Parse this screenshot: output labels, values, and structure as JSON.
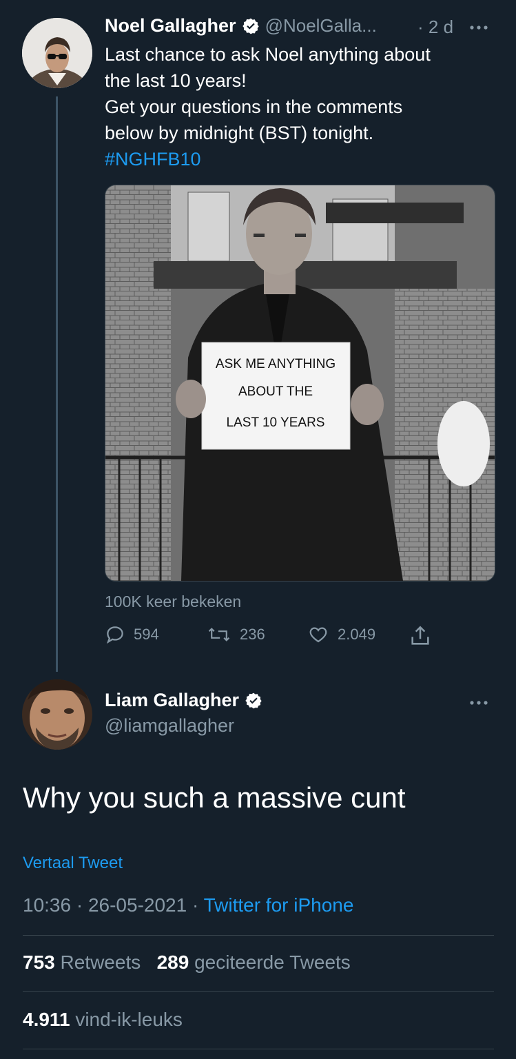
{
  "colors": {
    "background": "#15202b",
    "accent": "#1d9bf0",
    "muted": "#8899a6",
    "divider": "#38444d"
  },
  "parent_tweet": {
    "author_name": "Noel Gallagher",
    "handle": "@NoelGalla...",
    "time": "· 2 d",
    "more_icon": "more-dots-icon",
    "text_line1": "Last chance to ask Noel anything about",
    "text_line2": "the last 10 years!",
    "text_line3": "Get your questions in the comments",
    "text_line4": "below by midnight (BST) tonight.",
    "hashtag": "#NGHFB10",
    "media": {
      "sign_line1": "ASK ME ANYTHING",
      "sign_line2": "ABOUT THE",
      "sign_line3": "LAST 10 YEARS"
    },
    "views": "100K keer bekeken",
    "replies": "594",
    "retweets": "236",
    "likes": "2.049"
  },
  "reply_tweet": {
    "author_name": "Liam Gallagher",
    "handle": "@liamgallagher",
    "text": "Why you such a massive cunt",
    "translate": "Vertaal Tweet",
    "timestamp": "10:36 · 26-05-2021 · ",
    "source": "Twitter for iPhone",
    "retweets_count": "753",
    "retweets_label": "Retweets",
    "quotes_count": "289",
    "quotes_label": "geciteerde Tweets",
    "likes_count": "4.911",
    "likes_label": "vind-ik-leuks"
  }
}
